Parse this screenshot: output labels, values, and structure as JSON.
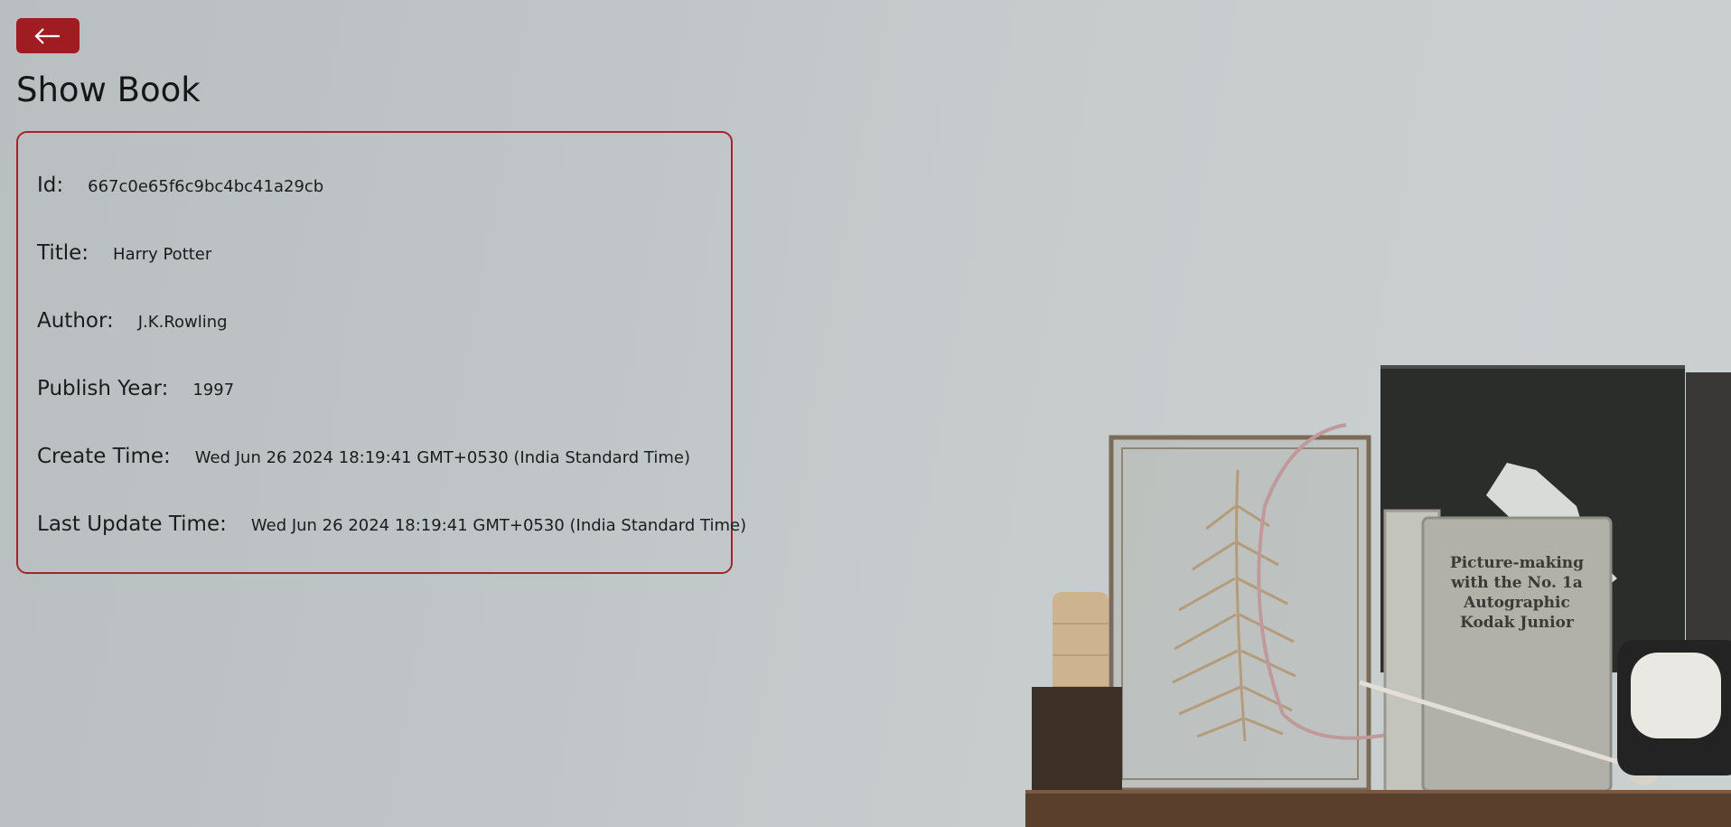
{
  "header": {
    "back_icon": "arrow-left-icon",
    "title": "Show Book"
  },
  "book": {
    "id_label": "Id:",
    "id_value": "667c0e65f6c9bc4bc41a29cb",
    "title_label": "Title:",
    "title_value": "Harry Potter",
    "author_label": "Author:",
    "author_value": "J.K.Rowling",
    "publish_year_label": "Publish Year:",
    "publish_year_value": "1997",
    "create_time_label": "Create Time:",
    "create_time_value": "Wed Jun 26 2024 18:19:41 GMT+0530 (India Standard Time)",
    "update_time_label": "Last Update Time:",
    "update_time_value": "Wed Jun 26 2024 18:19:41 GMT+0530 (India Standard Time)"
  },
  "background": {
    "booklet_text": [
      "Picture-making",
      "with the No. 1a",
      "Autographic",
      "Kodak Junior"
    ]
  },
  "colors": {
    "accent": "#9f1c20",
    "card_border": "#a3252a",
    "text": "#1c1c1c",
    "background": "#c3c8ca"
  }
}
